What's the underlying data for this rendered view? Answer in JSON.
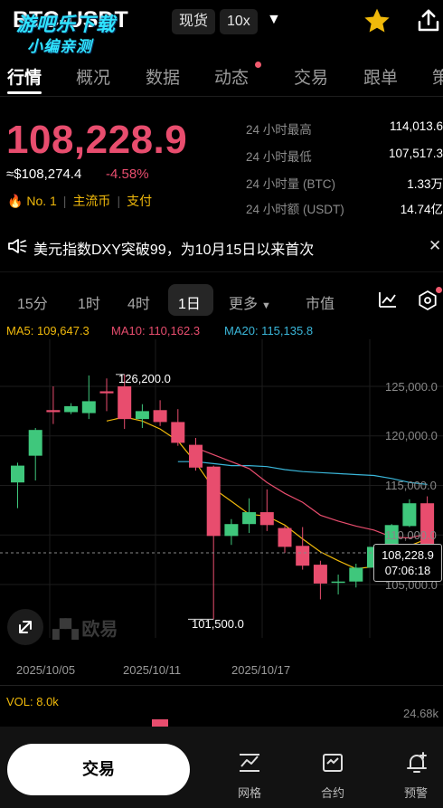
{
  "header": {
    "pair": "BTC-USDT",
    "watermark_line1": "游吧乐下载",
    "watermark_line2": "小编亲测",
    "spot_label": "现货",
    "leverage_label": "10x"
  },
  "tabs": [
    {
      "label": "行情",
      "active": true
    },
    {
      "label": "概况",
      "active": false
    },
    {
      "label": "数据",
      "active": false
    },
    {
      "label": "动态",
      "active": false,
      "dot": true
    },
    {
      "label": "交易",
      "active": false
    },
    {
      "label": "跟单",
      "active": false
    },
    {
      "label": "策",
      "active": false
    }
  ],
  "price": {
    "last": "108,228.9",
    "usd_value": "≈$108,274.4",
    "change": "-4.58%",
    "rank": "No. 1",
    "tag1": "主流币",
    "tag2": "支付"
  },
  "stats": [
    {
      "label": "24 小时最高",
      "value": "114,013.6"
    },
    {
      "label": "24 小时最低",
      "value": "107,517.3"
    },
    {
      "label": "24 小时量 (BTC)",
      "value": "1.33万"
    },
    {
      "label": "24 小时额 (USDT)",
      "value": "14.74亿"
    }
  ],
  "notice": {
    "text": "美元指数DXY突破99，为10月15日以来首次"
  },
  "intervals": {
    "items": [
      "15分",
      "1时",
      "4时",
      "1日",
      "更多",
      "市值"
    ],
    "selected": "1日"
  },
  "ma": {
    "ma5": "MA5: 109,647.3",
    "ma10": "MA10: 110,162.3",
    "ma20": "MA20: 115,135.8",
    "ma5_color": "#f0b90b",
    "ma10_color": "#e84d6e",
    "ma20_color": "#3ab6d9"
  },
  "colors": {
    "up": "#3fc77c",
    "down": "#e84d6e",
    "accent": "#f0b90b"
  },
  "chart_data": {
    "type": "candlestick",
    "interval": "1日",
    "yticks": [
      "125,000.0",
      "120,000.0",
      "115,000.0",
      "110,000.0",
      "105,000.0"
    ],
    "ytick_values": [
      125000,
      120000,
      115000,
      110000,
      105000
    ],
    "xticks": [
      "2025/10/05",
      "2025/10/11",
      "2025/10/17"
    ],
    "high_label": "126,200.0",
    "low_label": "101,500.0",
    "current_price": "108,228.9",
    "countdown": "07:06:18",
    "candles": [
      {
        "o": 115300,
        "h": 117300,
        "l": 112700,
        "c": 117000
      },
      {
        "o": 118000,
        "h": 120800,
        "l": 115500,
        "c": 120600
      },
      {
        "o": 122600,
        "h": 125000,
        "l": 121200,
        "c": 122400
      },
      {
        "o": 122400,
        "h": 123300,
        "l": 122200,
        "c": 123000
      },
      {
        "o": 122300,
        "h": 126100,
        "l": 121700,
        "c": 123500
      },
      {
        "o": 124500,
        "h": 125800,
        "l": 122500,
        "c": 124300
      },
      {
        "o": 125000,
        "h": 126200,
        "l": 120700,
        "c": 121700
      },
      {
        "o": 121700,
        "h": 123200,
        "l": 120800,
        "c": 122500
      },
      {
        "o": 122600,
        "h": 123600,
        "l": 121000,
        "c": 121400
      },
      {
        "o": 121400,
        "h": 122700,
        "l": 119000,
        "c": 119300
      },
      {
        "o": 119100,
        "h": 119800,
        "l": 116500,
        "c": 116800
      },
      {
        "o": 116900,
        "h": 117000,
        "l": 101500,
        "c": 109900
      },
      {
        "o": 109900,
        "h": 111600,
        "l": 109000,
        "c": 111100
      },
      {
        "o": 111100,
        "h": 113700,
        "l": 110200,
        "c": 112300
      },
      {
        "o": 112300,
        "h": 114600,
        "l": 110400,
        "c": 111000
      },
      {
        "o": 110700,
        "h": 110900,
        "l": 108200,
        "c": 108800
      },
      {
        "o": 108900,
        "h": 110800,
        "l": 106500,
        "c": 106900
      },
      {
        "o": 107000,
        "h": 107400,
        "l": 103500,
        "c": 105100
      },
      {
        "o": 105200,
        "h": 106000,
        "l": 104000,
        "c": 105300
      },
      {
        "o": 105300,
        "h": 107100,
        "l": 104700,
        "c": 106700
      },
      {
        "o": 106700,
        "h": 109000,
        "l": 106100,
        "c": 108800
      },
      {
        "o": 108700,
        "h": 111100,
        "l": 107400,
        "c": 111000
      },
      {
        "o": 110900,
        "h": 113600,
        "l": 110800,
        "c": 113200
      },
      {
        "o": 113200,
        "h": 113900,
        "l": 107400,
        "c": 108200
      }
    ],
    "ma5": [
      121500,
      121900,
      121500,
      120700,
      119500,
      117300,
      114700,
      113400,
      112100,
      111900,
      111000,
      109600,
      108300,
      107400,
      106600,
      106800,
      107400,
      108900,
      109600
    ],
    "ma10": [
      118800,
      118100,
      117400,
      116700,
      115300,
      114200,
      113300,
      112000,
      111400,
      110900,
      110500,
      109800,
      109700,
      110100
    ],
    "ma20": [
      117400,
      117400,
      117200,
      117000,
      117000,
      116900,
      116600,
      116400,
      116300,
      116200,
      116100,
      116000,
      115700,
      115300,
      115100
    ]
  },
  "volume": {
    "label": "VOL: 8.0k",
    "max_label": "24.68k"
  },
  "bottom_nav": {
    "trade": "交易",
    "grid": "网格",
    "contract": "合约",
    "alert": "预警"
  },
  "logo_text": "欧易"
}
